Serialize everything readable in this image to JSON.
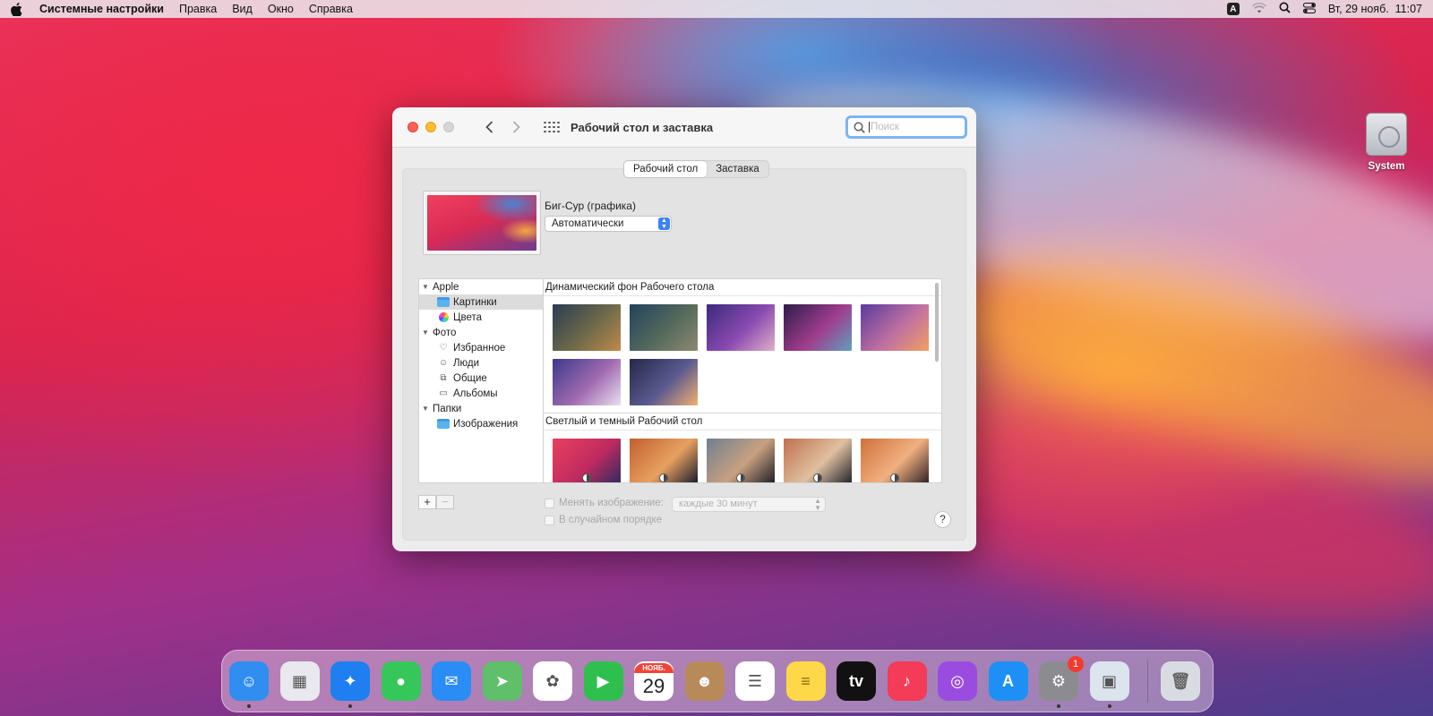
{
  "menubar": {
    "app_name": "Системные настройки",
    "items": [
      "Правка",
      "Вид",
      "Окно",
      "Справка"
    ],
    "input_badge": "A",
    "datetime": "Вт, 29 нояб.  11:07"
  },
  "desktop": {
    "disk_label": "System"
  },
  "window": {
    "title": "Рабочий стол и заставка",
    "search_placeholder": "Поиск",
    "tabs": [
      {
        "label": "Рабочий стол",
        "active": true
      },
      {
        "label": "Заставка",
        "active": false
      }
    ],
    "wallpaper_name": "Биг-Сур (графика)",
    "appearance_mode": "Автоматически",
    "sidebar": {
      "groups": [
        {
          "label": "Apple",
          "items": [
            {
              "label": "Картинки",
              "icon": "folder-icon",
              "selected": true
            },
            {
              "label": "Цвета",
              "icon": "colors-icon",
              "selected": false
            }
          ]
        },
        {
          "label": "Фото",
          "items": [
            {
              "label": "Избранное",
              "icon": "heart-icon",
              "selected": false
            },
            {
              "label": "Люди",
              "icon": "person-icon",
              "selected": false
            },
            {
              "label": "Общие",
              "icon": "shared-icon",
              "selected": false
            },
            {
              "label": "Альбомы",
              "icon": "album-icon",
              "selected": false
            }
          ]
        },
        {
          "label": "Папки",
          "items": [
            {
              "label": "Изображения",
              "icon": "folder-icon",
              "selected": false
            }
          ]
        }
      ]
    },
    "gallery": {
      "section1_title": "Динамический фон Рабочего стола",
      "section1_thumbs": [
        [
          "#2a3d52",
          "#6f6a4a",
          "#c08a4a"
        ],
        [
          "#22425e",
          "#556a5c",
          "#8f8a70"
        ],
        [
          "#3b2a7a",
          "#8a4ab0",
          "#e0b0c8"
        ],
        [
          "#2d1e4a",
          "#a03c8c",
          "#5fa0c0"
        ],
        [
          "#5a3aa0",
          "#c070a0",
          "#f0a060"
        ],
        [
          "#3a3a8a",
          "#a06ab0",
          "#e8e0f0"
        ],
        [
          "#252848",
          "#5a5a90",
          "#f0b070"
        ]
      ],
      "section2_title": "Светлый и темный Рабочий стол",
      "section2_thumbs": [
        [
          "#e8405c",
          "#c02a60",
          "#2a2a60"
        ],
        [
          "#c06030",
          "#e8a060",
          "#101828"
        ],
        [
          "#708090",
          "#c8a080",
          "#151a22"
        ],
        [
          "#c07050",
          "#e0c0a0",
          "#1a1c28"
        ],
        [
          "#d0703a",
          "#f0b080",
          "#2a1a20"
        ]
      ]
    },
    "add_button": "+",
    "remove_button": "−",
    "change_picture_label": "Менять изображение:",
    "interval_value": "каждые 30 минут",
    "random_order_label": "В случайном порядке",
    "help_button": "?"
  },
  "dock": {
    "items": [
      {
        "name": "finder",
        "color": "#2f8ef0",
        "glyph": "☺",
        "running": true
      },
      {
        "name": "launchpad",
        "color": "#e8e8ee",
        "glyph": "▦",
        "running": false
      },
      {
        "name": "safari",
        "color": "#1f7ff0",
        "glyph": "✦",
        "running": true
      },
      {
        "name": "messages",
        "color": "#35c759",
        "glyph": "●",
        "running": false
      },
      {
        "name": "mail",
        "color": "#2a8cf5",
        "glyph": "✉",
        "running": false
      },
      {
        "name": "maps",
        "color": "#5fbf6a",
        "glyph": "➤",
        "running": false
      },
      {
        "name": "photos",
        "color": "#ffffff",
        "glyph": "✿",
        "running": false
      },
      {
        "name": "facetime",
        "color": "#2fbf4f",
        "glyph": "▶",
        "running": false
      },
      {
        "name": "calendar",
        "color": "#ffffff",
        "glyph": "",
        "running": false
      },
      {
        "name": "contacts",
        "color": "#b88a5a",
        "glyph": "☻",
        "running": false
      },
      {
        "name": "reminders",
        "color": "#ffffff",
        "glyph": "☰",
        "running": false
      },
      {
        "name": "notes",
        "color": "#ffd84a",
        "glyph": "≡",
        "running": false
      },
      {
        "name": "tv",
        "color": "#111111",
        "glyph": "tv",
        "running": false
      },
      {
        "name": "music",
        "color": "#f43b58",
        "glyph": "♪",
        "running": false
      },
      {
        "name": "podcasts",
        "color": "#9b4ce0",
        "glyph": "◎",
        "running": false
      },
      {
        "name": "app-store",
        "color": "#1e90f5",
        "glyph": "A",
        "running": false
      },
      {
        "name": "system-preferences",
        "color": "#8c8c90",
        "glyph": "⚙",
        "running": true
      },
      {
        "name": "preview",
        "color": "#dce4ee",
        "glyph": "▣",
        "running": true
      }
    ],
    "calendar_month": "НОЯБ.",
    "calendar_day": "29",
    "sysprefs_badge": "1",
    "trash": {
      "name": "trash",
      "color": "#d8dce2",
      "glyph": "🗑"
    }
  }
}
